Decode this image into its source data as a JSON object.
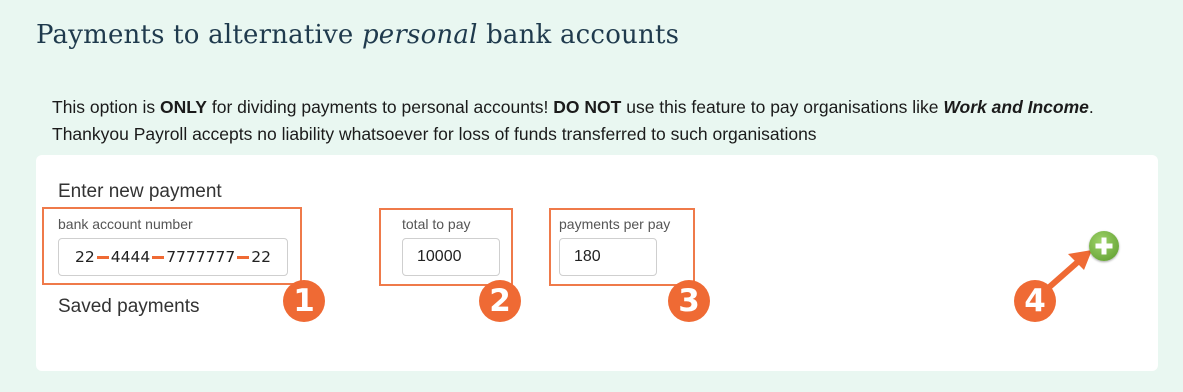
{
  "header": {
    "title_before": "Payments to alternative",
    "title_em": "personal",
    "title_after": "bank accounts"
  },
  "warning": {
    "p1": "This option is ",
    "b1": "ONLY",
    "p2": " for dividing payments to personal accounts! ",
    "b2": "DO NOT",
    "p3": " use this feature to pay organisations like ",
    "b3": "Work and Income",
    "p4": ". Thankyou Payroll accepts no liability whatsoever for loss of funds transferred to such organisations"
  },
  "form": {
    "enter_new_label": "Enter new payment",
    "bank_account": {
      "label": "bank account number",
      "seg1": "22",
      "seg2": "4444",
      "seg3": "7777777",
      "seg4": "22"
    },
    "total_to_pay": {
      "label": "total to pay",
      "value": "10000"
    },
    "payments_per_pay": {
      "label": "payments per pay",
      "value": "180"
    },
    "saved_label": "Saved payments"
  },
  "markers": [
    "1",
    "2",
    "3",
    "4"
  ],
  "icons": {
    "add": "plus-circle-icon",
    "arrow": "arrow-icon"
  },
  "colors": {
    "highlight": "#ef7a4a",
    "marker": "#ef6a34",
    "add_button": "#6fae36",
    "background": "#e9f7f1"
  }
}
